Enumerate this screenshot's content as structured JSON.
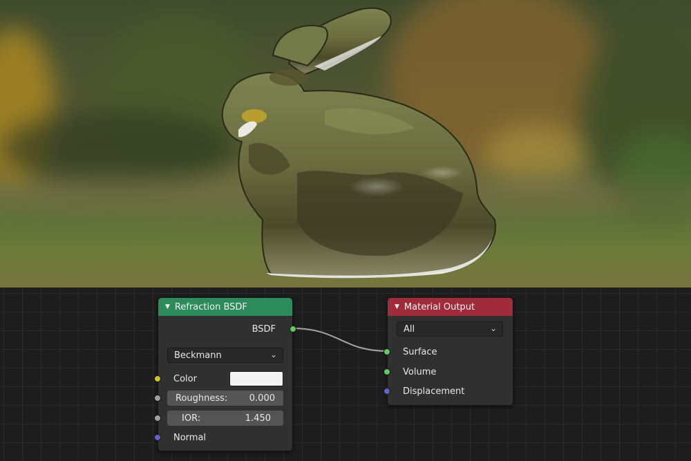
{
  "viewport": {
    "description_colors": {
      "foliage_dark": "#3f4b2d",
      "foliage_autumn": "#876630",
      "grass": "#6d7a3a",
      "bunny_glass": "#6f7448"
    }
  },
  "node_editor": {
    "grid_color": "#2a2a2a",
    "background_color": "#1d1d1d",
    "link_color": "#a6a6a6",
    "refraction_node": {
      "title": "Refraction BSDF",
      "header_color": "#2c8a5b",
      "output_socket": "BSDF",
      "distribution": "Beckmann",
      "inputs": {
        "color_label": "Color",
        "color_value": "#f2f2f2",
        "roughness_label": "Roughness:",
        "roughness_value": "0.000",
        "ior_label": "IOR:",
        "ior_value": "1.450",
        "normal_label": "Normal"
      }
    },
    "output_node": {
      "title": "Material Output",
      "header_color": "#a02b3b",
      "target": "All",
      "inputs": [
        "Surface",
        "Volume",
        "Displacement"
      ]
    }
  }
}
